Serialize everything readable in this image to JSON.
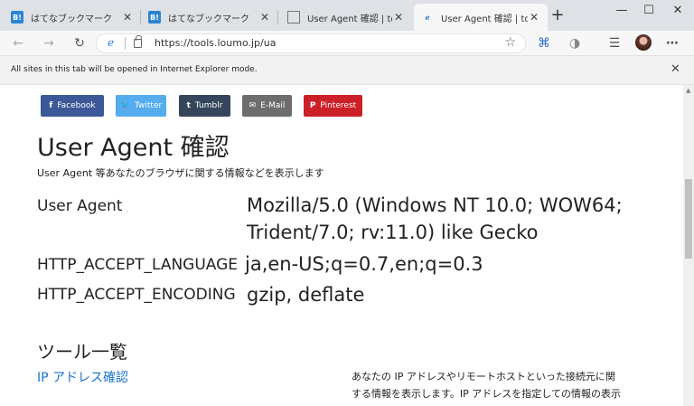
{
  "browser": {
    "tabs": [
      {
        "title": "はてなブックマーク",
        "favicon": "hatena-bookmark-icon",
        "favicon_text": "B!",
        "active": false
      },
      {
        "title": "はてなブックマーク",
        "favicon": "hatena-bookmark-icon",
        "favicon_text": "B!",
        "active": false
      },
      {
        "title": "User Agent 確認 | tools.lo",
        "favicon": "document-icon",
        "active": false
      },
      {
        "title": "User Agent 確認 | tools.lo",
        "favicon": "ie-icon",
        "active": true
      }
    ],
    "address": {
      "url": "https://tools.loumo.jp/ua"
    },
    "infobar": {
      "message": "All sites in this tab will be opened in Internet Explorer mode."
    }
  },
  "page": {
    "share_buttons": [
      {
        "label": "Facebook",
        "icon": "f",
        "color": "#3b5998"
      },
      {
        "label": "Twitter",
        "icon": "🐦",
        "color": "#55acee"
      },
      {
        "label": "Tumblr",
        "icon": "t",
        "color": "#35465c"
      },
      {
        "label": "E-Mail",
        "icon": "✉",
        "color": "#6d6d6d"
      },
      {
        "label": "Pinterest",
        "icon": "P",
        "color": "#cb2027"
      }
    ],
    "title": "User Agent 確認",
    "lead": "User Agent 等あなたのブラウザに関する情報などを表示します",
    "info": {
      "ua_label": "User Agent",
      "ua_line1": "Mozilla/5.0 (Windows NT 10.0; WOW64;",
      "ua_line2": "Trident/7.0; rv:11.0) like Gecko",
      "lang_label": "HTTP_ACCEPT_LANGUAGE",
      "lang_value": "ja,en-US;q=0.7,en;q=0.3",
      "enc_label": "HTTP_ACCEPT_ENCODING",
      "enc_value": "gzip, deflate"
    },
    "tools_heading": "ツール一覧",
    "tool": {
      "link": "IP アドレス確認",
      "desc_line1": "あなたの IP アドレスやリモートホストといった接続元に関",
      "desc_line2": "する情報を表示します。IP アドレスを指定しての情報の表示"
    }
  }
}
